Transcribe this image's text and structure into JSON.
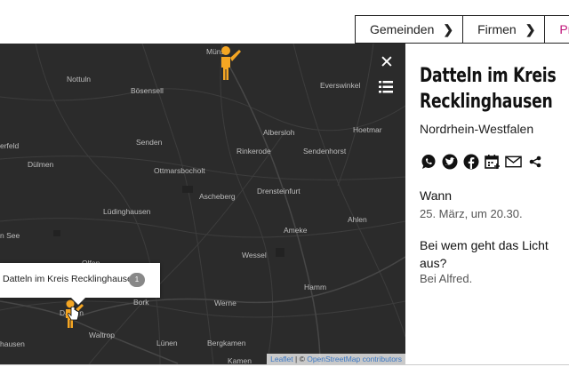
{
  "nav": {
    "tabs": [
      {
        "label": "Gemeinden"
      },
      {
        "label": "Firmen"
      },
      {
        "label": "Priva"
      }
    ]
  },
  "map": {
    "places": [
      {
        "name": "Müns"
      },
      {
        "name": "Nottuln"
      },
      {
        "name": "Bösensell"
      },
      {
        "name": "Everswinkel"
      },
      {
        "name": "Albersloh"
      },
      {
        "name": "Hoetmar"
      },
      {
        "name": "erfeld"
      },
      {
        "name": "Senden"
      },
      {
        "name": "Rinkerode"
      },
      {
        "name": "Sendenhorst"
      },
      {
        "name": "Dülmen"
      },
      {
        "name": "Ottmarsbocholt"
      },
      {
        "name": "Ascheberg"
      },
      {
        "name": "Drensteinfurt"
      },
      {
        "name": "Lüdinghausen"
      },
      {
        "name": "Ahlen"
      },
      {
        "name": "n See"
      },
      {
        "name": "Ameke"
      },
      {
        "name": "Olfen"
      },
      {
        "name": "Wessel"
      },
      {
        "name": "Hamm"
      },
      {
        "name": "Datteln"
      },
      {
        "name": "Bork"
      },
      {
        "name": "Werne"
      },
      {
        "name": "Waltrop"
      },
      {
        "name": "hausen"
      },
      {
        "name": "Lünen"
      },
      {
        "name": "Bergkamen"
      },
      {
        "name": "Kamen"
      }
    ],
    "popup": {
      "text": "Datteln im Kreis Recklinghausen",
      "count": "1"
    },
    "attribution": {
      "leaflet": "Leaflet",
      "sep": " | © ",
      "osm": "OpenStreetMap contributors"
    },
    "icons": {
      "close": "close-icon",
      "list": "list-icon",
      "marker": "person-marker-icon"
    },
    "colors": {
      "marker": "#f5a623",
      "accent": "#c0157a",
      "map_bg": "#2b2b2b"
    }
  },
  "panel": {
    "title": "Datteln im Kreis Recklinghausen",
    "region": "Nordrhein-Westfalen",
    "share_icons": [
      "whatsapp-icon",
      "twitter-icon",
      "facebook-icon",
      "calendar-icon",
      "email-icon",
      "share-icon"
    ],
    "when_label": "Wann",
    "when_value": "25. März, um 20.30.",
    "who_label": "Bei wem geht das Licht aus?",
    "who_value": "Bei Alfred."
  }
}
